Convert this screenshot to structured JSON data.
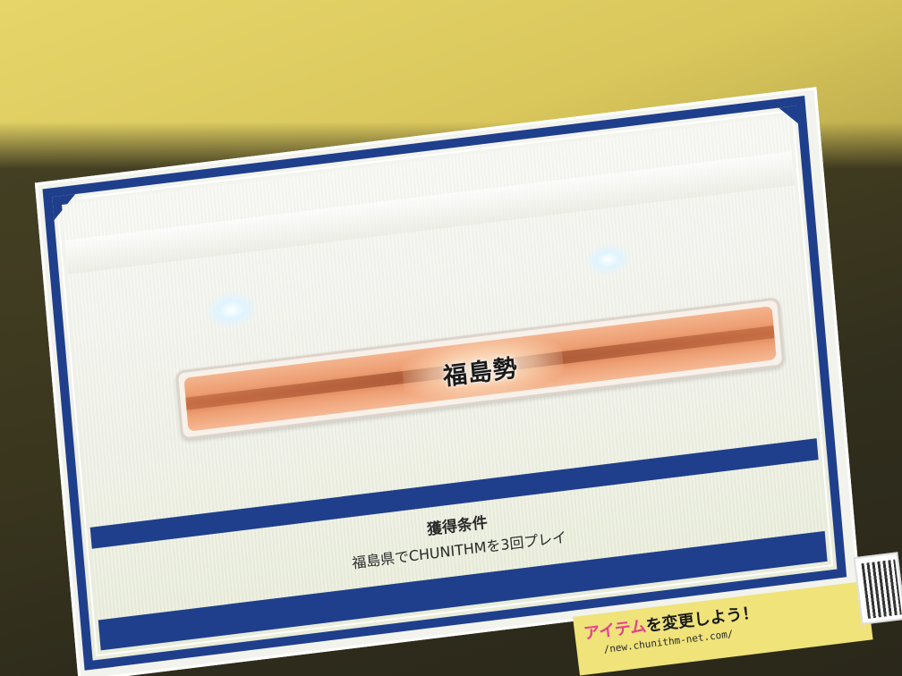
{
  "panel": {
    "title": "福島勢",
    "condition_label": "獲得条件",
    "condition_text": "福島県でCHUNITHMを3回プレイ",
    "footer_text": ""
  },
  "sticker": {
    "highlight": "アイテム",
    "suffix": "を変更しよう！",
    "url": "/new.chunithm-net.com/"
  },
  "colors": {
    "frame_blue": "#1f3f8c",
    "title_orange": "#ee9f73",
    "sticker_yellow": "#efe37a",
    "sticker_pink": "#e8408e"
  }
}
